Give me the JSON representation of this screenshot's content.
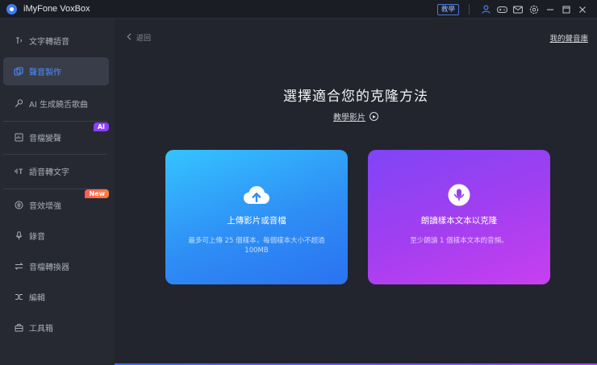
{
  "app": {
    "title": "iMyFone VoxBox",
    "tutorial_button": "教學"
  },
  "titlebar_icons": [
    "user-icon",
    "gamepad-icon",
    "mail-icon",
    "settings-icon",
    "minimize-icon",
    "maximize-icon",
    "close-icon"
  ],
  "sidebar": {
    "items": [
      {
        "label": "文字轉語音",
        "icon": "text-to-speech-icon"
      },
      {
        "label": "聲音製作",
        "icon": "voice-clone-icon",
        "active": true
      },
      {
        "label": "AI 生成饒舌歌曲",
        "icon": "ai-rap-icon"
      },
      {
        "label": "音檔變聲",
        "icon": "voice-changer-icon",
        "badge": "AI"
      },
      {
        "label": "語音轉文字",
        "icon": "speech-to-text-icon"
      },
      {
        "label": "音效增強",
        "icon": "audio-enhance-icon",
        "badge": "New"
      },
      {
        "label": "錄音",
        "icon": "microphone-icon"
      },
      {
        "label": "音檔轉換器",
        "icon": "convert-icon"
      },
      {
        "label": "編輯",
        "icon": "edit-icon"
      },
      {
        "label": "工具箱",
        "icon": "toolbox-icon"
      }
    ]
  },
  "main": {
    "back_label": "返回",
    "my_library": "我的聲音庫",
    "heading": "選擇適合您的克隆方法",
    "tutorial_video": "教學影片",
    "cards": [
      {
        "title": "上傳影片或音檔",
        "desc": "最多可上傳 25 個樣本，每個樣本大小不超過 100MB",
        "icon": "cloud-upload-icon"
      },
      {
        "title": "朗讀樣本文本以克隆",
        "desc": "至少朗讀 1 個樣本文本的音頻。",
        "icon": "microphone-icon"
      }
    ]
  },
  "colors": {
    "accent": "#4d8dff",
    "upload_card": "#2e8ef5",
    "record_card": "#a13ff0",
    "ai_badge": "#8a3ffc",
    "new_badge": "#ff5a5a"
  }
}
